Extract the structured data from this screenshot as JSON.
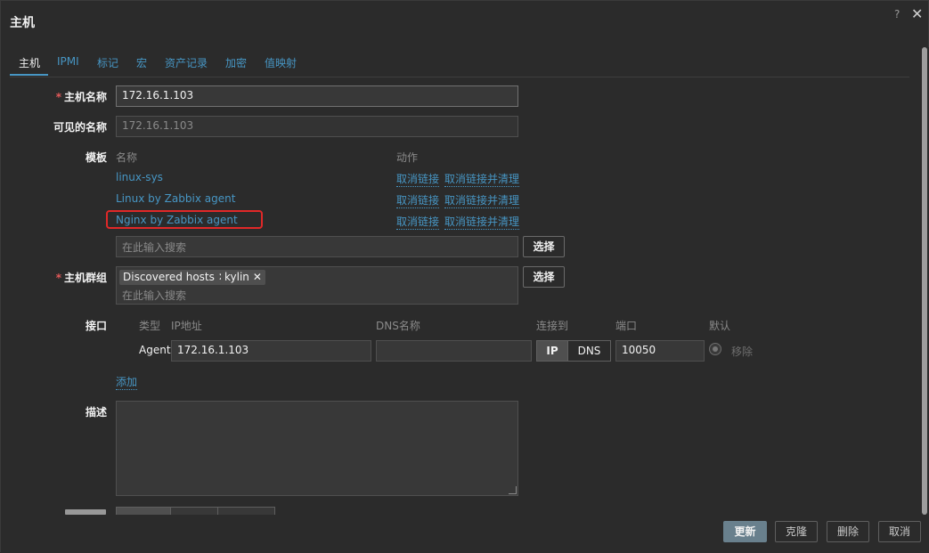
{
  "dialog": {
    "title": "主机",
    "help": "?",
    "close": "✕"
  },
  "tabs": [
    {
      "label": "主机",
      "active": true
    },
    {
      "label": "IPMI"
    },
    {
      "label": "标记"
    },
    {
      "label": "宏"
    },
    {
      "label": "资产记录"
    },
    {
      "label": "加密"
    },
    {
      "label": "值映射"
    }
  ],
  "form": {
    "host_name": {
      "label": "主机名称",
      "required": "*",
      "value": "172.16.1.103"
    },
    "visible_name": {
      "label": "可见的名称",
      "value": "172.16.1.103"
    },
    "templates": {
      "label": "模板",
      "col_name": "名称",
      "col_action": "动作",
      "items": [
        {
          "name": "linux-sys",
          "unlink": "取消链接",
          "unlink_clear": "取消链接并清理"
        },
        {
          "name": "Linux by Zabbix agent",
          "unlink": "取消链接",
          "unlink_clear": "取消链接并清理"
        },
        {
          "name": "Nginx by Zabbix agent",
          "unlink": "取消链接",
          "unlink_clear": "取消链接并清理"
        }
      ],
      "search_placeholder": "在此输入搜索",
      "select_label": "选择"
    },
    "host_groups": {
      "label": "主机群组",
      "required": "*",
      "chips": [
        {
          "label": "Discovered hosts",
          "remove": "✕"
        },
        {
          "label": "kylin",
          "remove": "✕"
        }
      ],
      "search_placeholder": "在此输入搜索",
      "select_label": "选择"
    },
    "interfaces": {
      "label": "接口",
      "headers": {
        "type": "类型",
        "ip": "IP地址",
        "dns": "DNS名称",
        "connect": "连接到",
        "port": "端口",
        "default": "默认"
      },
      "row": {
        "type": "Agent",
        "ip": "172.16.1.103",
        "dns": "",
        "connect_ip": "IP",
        "connect_dns": "DNS",
        "port": "10050",
        "remove": "移除"
      },
      "add_label": "添加"
    },
    "description": {
      "label": "描述",
      "value": ""
    }
  },
  "footer": {
    "update": "更新",
    "clone": "克隆",
    "delete": "删除",
    "cancel": "取消"
  }
}
